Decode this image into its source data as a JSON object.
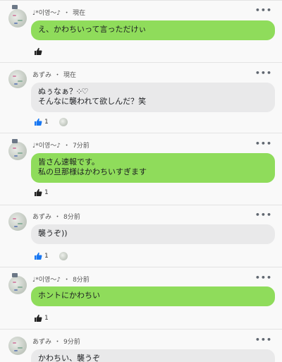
{
  "comments": [
    {
      "author": "♩*이영～♪",
      "time": "現在",
      "lines": [
        "え、かわちいって言っただけぃ"
      ],
      "likes": "",
      "liked": false
    },
    {
      "author": "あずみ",
      "time": "現在",
      "lines": [
        "ぬぅなぁ？༶♡",
        "そんなに襲われて欲しんだ？笑"
      ],
      "likes": "1",
      "liked": true
    },
    {
      "author": "♩*이영～♪",
      "time": "7分前",
      "lines": [
        "皆さん速報です。",
        "私の旦那様はかわちいすぎます"
      ],
      "likes": "1",
      "liked": false
    },
    {
      "author": "あずみ",
      "time": "8分前",
      "lines": [
        "襲うぞ))"
      ],
      "likes": "1",
      "liked": true
    },
    {
      "author": "♩*이영～♪",
      "time": "8分前",
      "lines": [
        "ホントにかわちい"
      ],
      "likes": "1",
      "liked": false
    },
    {
      "author": "あずみ",
      "time": "9分前",
      "lines": [
        "かわちい、襲うぞ"
      ],
      "likes": "",
      "liked": false
    }
  ],
  "separator": "・",
  "more_label": "•••",
  "colors": {
    "own_bubble": "#8fdc5b",
    "other_bubble": "#e9e9ea",
    "liked_thumb": "#1877f2",
    "thumb": "#222222"
  },
  "icons": {
    "like": "thumbs-up-icon",
    "more": "more-options-icon"
  }
}
